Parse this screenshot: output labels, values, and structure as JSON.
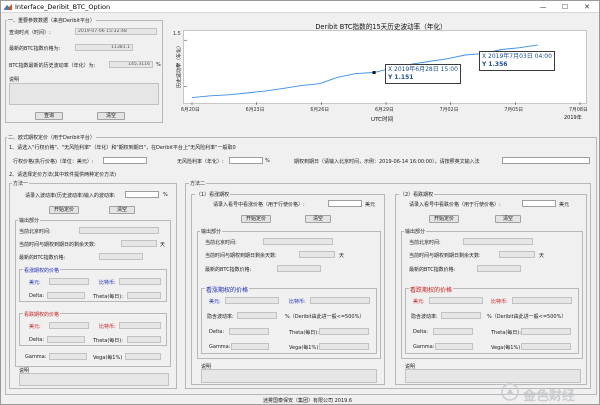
{
  "window": {
    "title": "Interface_Deribit_BTC_Option",
    "minimize": "—",
    "maximize": "☐",
    "close": "✕"
  },
  "section1": {
    "legend": "一、重要参数数据（来自Deribit平台）",
    "query_time_label": "查询时点（时间）:",
    "query_time_value": "2019-07-06 15:32:48",
    "btc_price_label": "最新的BTC指数价格为:",
    "btc_price_value": "11381.1",
    "vol_label": "BTC指数最新的历史波动率（年化）为:",
    "vol_value": "145.3116",
    "vol_unit": "%",
    "notes_label": "说明",
    "query_button": "查询",
    "clear_button": "清空"
  },
  "chart_data": {
    "type": "line",
    "title": "Deribit BTC指数的15天历史波动率（年化）",
    "xlabel": "UTC时间",
    "ylabel": "历史波动率（年化）",
    "year_label": "2019年",
    "x_ticks": [
      "6月20日",
      "6月23日",
      "6月26日",
      "6月29日",
      "7月02日",
      "7月05日",
      "7月08日"
    ],
    "y_ticks": [
      "1",
      "1.5"
    ],
    "ylim": [
      0.8,
      1.6
    ],
    "series": [
      {
        "x": [
          "6月20日",
          "6月21日",
          "6月22日",
          "6月23日",
          "6月24日",
          "6月25日",
          "6月26日",
          "6月26日12时",
          "6月27日",
          "6月28日",
          "6月28日15时",
          "6月29日",
          "6月30日",
          "7月01日",
          "7月02日",
          "7月03日",
          "7月03日04时",
          "7月04日",
          "7月05日",
          "7月06日"
        ],
        "values": [
          0.88,
          0.9,
          0.91,
          0.93,
          0.95,
          0.98,
          1.01,
          1.03,
          1.1,
          1.14,
          1.151,
          1.2,
          1.24,
          1.27,
          1.3,
          1.34,
          1.356,
          1.4,
          1.42,
          1.45
        ]
      }
    ],
    "annotations": [
      {
        "x_label": "X 2019年6月28日 15:00",
        "y_label": "Y 1.151"
      },
      {
        "x_label": "X 2019年7月03日 04:00",
        "y_label": "Y 1.356"
      }
    ]
  },
  "section2": {
    "legend": "二、欧式期权定价（用于Deribit平台）",
    "instr1": "1、请选入\"行权价格\"、\"无风险利率\"（年化）和\"期权到期日\"，在Deribit平台上\"无风险利率\"一般取0",
    "strike_label": "行权价格(执行价格)（单位：美元）:",
    "rate_label": "无风险利率（年化）:",
    "rate_unit": "%",
    "expiry_label": "期权到期日（请输入北京时间，示例：2019-06-14 16:00:00），请按照英文输入法",
    "instr2": "2、请选择定价方法(其中软件提供两种定价方法)"
  },
  "method1": {
    "legend": "方法一",
    "vol_input_label": "请录入波动率(历史波动率)输入的波动率:",
    "vol_unit": "%",
    "price_button": "开始定价",
    "clear_button": "清空",
    "output_legend": "输出部分",
    "current_time_label": "当前北京时间:",
    "days_label": "当前时间与期权到期日的剩余天数:",
    "days_unit": "天",
    "btc_label": "最新的BTC指数价格:",
    "call_title": "看涨期权的价格",
    "call_usd": "美元:",
    "call_btc": "比特币:",
    "delta": "Delta:",
    "theta": "Theta(每日):",
    "put_title": "看跌期权的价格",
    "put_usd": "美元:",
    "put_btc": "比特币:",
    "gamma": "Gamma:",
    "vega": "Vega(每1%)",
    "notes": "说明"
  },
  "method2": {
    "legend": "方法二",
    "call_section": {
      "legend": "（1）看涨期权",
      "input_label": "请录入看号中看涨价格（用于行使价格）:",
      "unit": "美元",
      "price_button": "开始定价",
      "clear_button": "清空",
      "output_legend": "输出部分",
      "current_time_label": "当前北京时间:",
      "days_label": "当前时间与期权到期日剩余天数:",
      "days_unit": "天",
      "btc_label": "最新的BTC指数价格:",
      "price_title": "看涨期权的价格",
      "usd": "美元:",
      "btc": "比特币:",
      "iv_label": "隐含波动率:",
      "iv_unit": "%（Deribit由此进一般<=500%）",
      "delta": "Delta:",
      "theta": "Theta(每日):",
      "gamma": "Gamma:",
      "vega": "Vega(每1%)",
      "notes": "说明"
    },
    "put_section": {
      "legend": "（2）看跌期权",
      "input_label": "请录入看号中看跌价格（用于行使价格）:",
      "unit": "美元",
      "price_button": "开始定价",
      "clear_button": "清空",
      "output_legend": "输出部分",
      "current_time_label": "当前北京时间:",
      "days_label": "当前时间与期权到期日剩余天数:",
      "days_unit": "天",
      "btc_label": "最新的BTC指数价格:",
      "price_title": "看跌期权的价格",
      "usd": "美元:",
      "btc": "比特币:",
      "iv_label": "隐含波动率:",
      "iv_unit": "%（Deribit由此进一般<=500%）",
      "delta": "Delta:",
      "theta": "Theta(每日):",
      "gamma": "Gamma:",
      "vega": "Vega(每1%)",
      "notes": "说明"
    }
  },
  "footer": {
    "text": "迷雾国泰保安（集团）有限公司  2019.6",
    "watermark": "金色财经"
  },
  "colors": {
    "window_bg": "#f0f0f0",
    "line": "#3a8ee6",
    "label_blue": "#1b2fb3",
    "label_red": "#c41e1e"
  }
}
